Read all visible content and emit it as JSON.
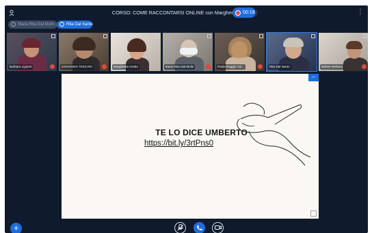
{
  "header": {
    "users_icon": "users-icon",
    "title": "CORSO: COME RACCONTARSI ONLINE con Margherita Grotto",
    "separator": "|",
    "recording_time": "00:18",
    "menu_icon": "⋮"
  },
  "presenters": [
    {
      "label": "Maria Rita Dal Molin"
    },
    {
      "label": "Rita Dal Santo"
    }
  ],
  "participants": [
    {
      "name": "Barbara Lignieri",
      "muted": true
    },
    {
      "name": "GIOVANNA TESCARI",
      "muted": true
    },
    {
      "name": "Margherita Grotto",
      "muted": false
    },
    {
      "name": "Maria Rita Dal Molin",
      "muted": true
    },
    {
      "name": "Paola Reggio Asi...",
      "muted": true
    },
    {
      "name": "Rita Dal Santo",
      "muted": false
    },
    {
      "name": "stefani stefania",
      "muted": true
    }
  ],
  "slide": {
    "headline": "TE LO DICE UMBERTO",
    "link": "https://bit.ly/3rtPns0",
    "minimize_label": "–"
  },
  "controls": {
    "plus": "+",
    "mic": "mic-icon",
    "phone": "phone-icon",
    "camera": "camera-icon"
  },
  "colors": {
    "background": "#0f1b2c",
    "accent": "#1e6de0",
    "mute": "#e5483d",
    "slide_bg": "#fbf8f3"
  }
}
